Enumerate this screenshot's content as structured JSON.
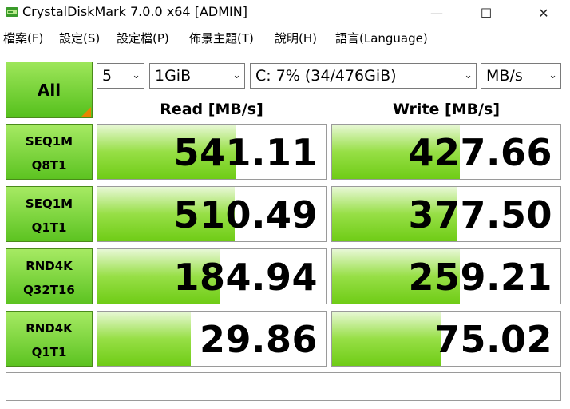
{
  "window": {
    "title": "CrystalDiskMark 7.0.0 x64 [ADMIN]",
    "minimize_glyph": "—",
    "maximize_glyph": "☐",
    "close_glyph": "✕"
  },
  "menu": [
    "檔案(F)",
    "設定(S)",
    "設定檔(P)",
    "佈景主題(T)",
    "說明(H)",
    "語言(Language)"
  ],
  "controls": {
    "count": "5",
    "size": "1GiB",
    "drive": "C: 7% (34/476GiB)",
    "unit": "MB/s",
    "all_label": "All"
  },
  "headers": {
    "read": "Read [MB/s]",
    "write": "Write [MB/s]"
  },
  "rows": [
    {
      "line1": "SEQ1M",
      "line2": "Q8T1",
      "read": "541.11",
      "write": "427.66",
      "read_fill": 0.61,
      "write_fill": 0.56
    },
    {
      "line1": "SEQ1M",
      "line2": "Q1T1",
      "read": "510.49",
      "write": "377.50",
      "read_fill": 0.6,
      "write_fill": 0.55
    },
    {
      "line1": "RND4K",
      "line2": "Q32T16",
      "read": "184.94",
      "write": "259.21",
      "read_fill": 0.54,
      "write_fill": 0.56
    },
    {
      "line1": "RND4K",
      "line2": "Q1T1",
      "read": "29.86",
      "write": "75.02",
      "read_fill": 0.41,
      "write_fill": 0.48
    }
  ],
  "comment": ""
}
